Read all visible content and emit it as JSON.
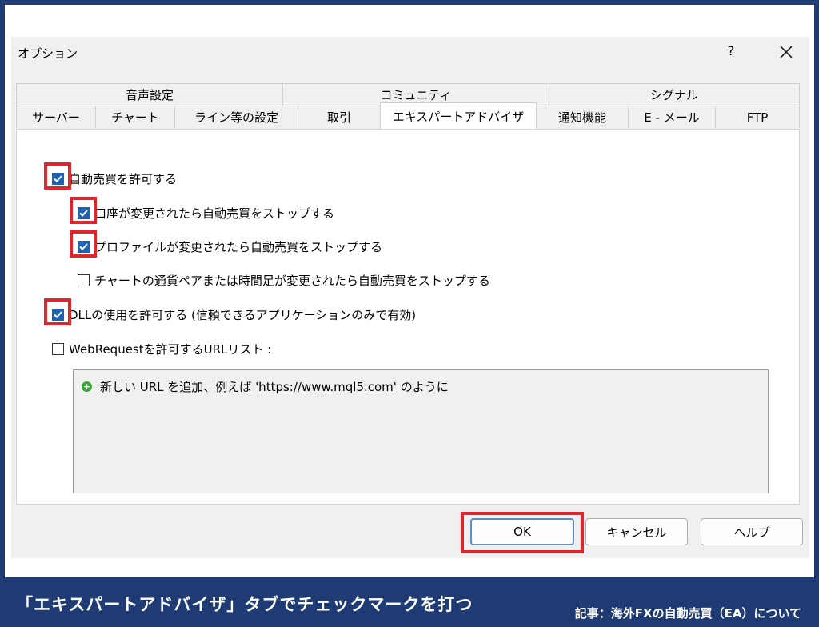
{
  "dialog": {
    "title": "オプション",
    "help_label": "?",
    "close_label": "✕"
  },
  "tabs_top": [
    {
      "label": "音声設定"
    },
    {
      "label": "コミュニティ"
    },
    {
      "label": "シグナル"
    }
  ],
  "tabs_bottom": [
    {
      "label": "サーバー"
    },
    {
      "label": "チャート"
    },
    {
      "label": "ライン等の設定"
    },
    {
      "label": "取引"
    },
    {
      "label": "エキスパートアドバイザ",
      "active": true
    },
    {
      "label": "通知機能"
    },
    {
      "label": "E - メール"
    },
    {
      "label": "FTP"
    }
  ],
  "options": [
    {
      "label": "自動売買を許可する",
      "checked": true
    },
    {
      "label": "口座が変更されたら自動売買をストップする",
      "checked": true
    },
    {
      "label": "プロファイルが変更されたら自動売買をストップする",
      "checked": true
    },
    {
      "label": "チャートの通貨ペアまたは時間足が変更されたら自動売買をストップする",
      "checked": false
    },
    {
      "label": "DLLの使用を許可する (信頼できるアプリケーションのみで有効)",
      "checked": true
    },
    {
      "label": "WebRequestを許可するURLリスト :",
      "checked": false
    }
  ],
  "url_list": {
    "placeholder": "新しい URL を追加、例えば 'https://www.mql5.com' のように"
  },
  "buttons": {
    "ok": "OK",
    "cancel": "キャンセル",
    "help": "ヘルプ"
  },
  "caption": {
    "main": "「エキスパートアドバイザ」タブでチェックマークを打つ",
    "sub": "記事：海外FXの自動売買（EA）について"
  },
  "colors": {
    "highlight": "#e0262d",
    "checkbox": "#1e62b4",
    "banner": "#1f3b73"
  }
}
